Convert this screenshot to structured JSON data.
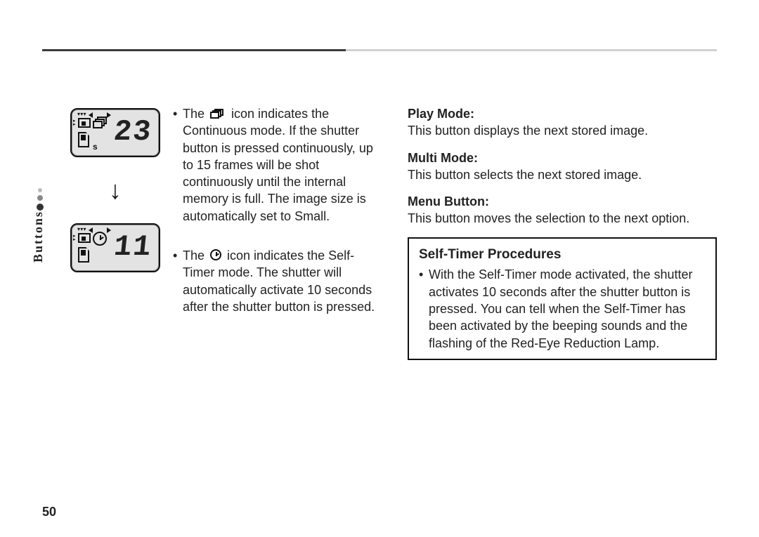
{
  "section_label": "Buttons",
  "page_number": "50",
  "lcd_top": {
    "digits": "23",
    "s_mark": "s"
  },
  "lcd_bottom": {
    "digits": "11"
  },
  "bullet1_pre": "The ",
  "bullet1_post": " icon indicates the Continuous mode. If the shutter button is pressed continuously, up to 15 frames will be shot continuously until the internal memory is full. The image size is automatically set to Small.",
  "bullet2_pre": "The ",
  "bullet2_post": " icon indicates the Self-Timer mode. The shutter will automatically activate 10 seconds after the shutter button is pressed.",
  "play": {
    "title": "Play Mode:",
    "text": "This button displays the next stored image."
  },
  "multi": {
    "title": "Multi Mode:",
    "text": "This button selects the next stored image."
  },
  "menu": {
    "title": "Menu Button:",
    "text": "This button moves the selection to the next option."
  },
  "box": {
    "title": "Self-Timer Procedures",
    "text": "With the Self-Timer mode activated, the shutter activates 10 seconds after the shutter button is pressed. You can tell when the Self-Timer has been activated by the beeping sounds and the flashing of the Red-Eye Reduction Lamp."
  }
}
